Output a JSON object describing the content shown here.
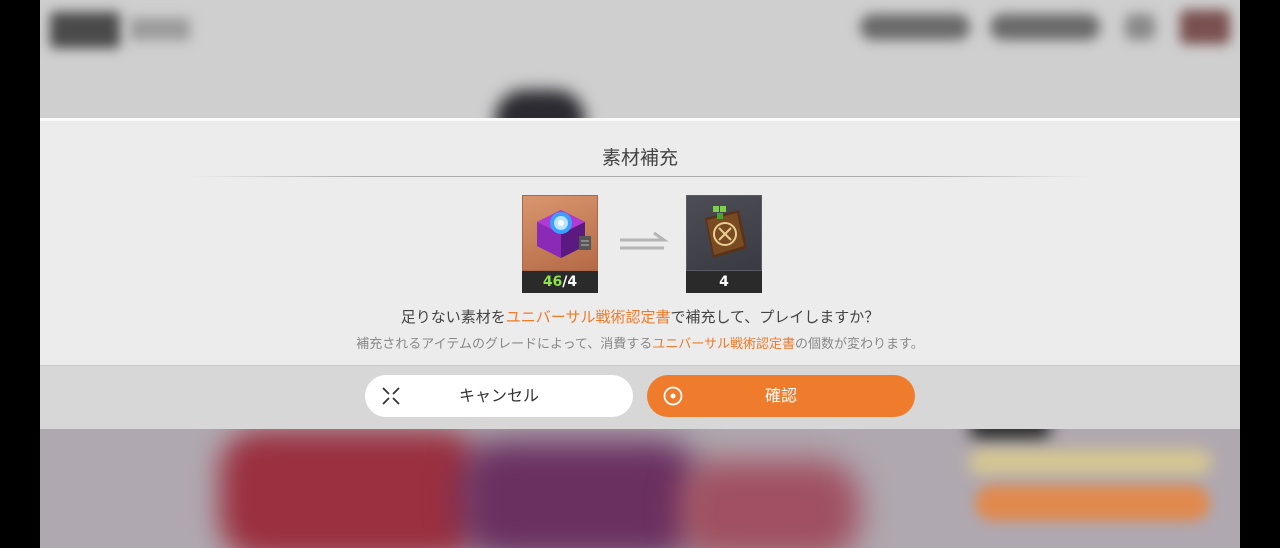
{
  "dialog": {
    "title": "素材補充",
    "source_item": {
      "have": "46",
      "sep": "/",
      "need": "4",
      "icon": "blue-core-cube-icon"
    },
    "target_item": {
      "count": "4",
      "icon": "tactics-certificate-book-icon"
    },
    "message": {
      "prefix": "足りない素材を",
      "highlight": "ユニバーサル戦術認定書",
      "suffix": "で補充して、プレイしますか？"
    },
    "note": {
      "prefix": "補充されるアイテムのグレードによって、消費する",
      "highlight": "ユニバーサル戦術認定書",
      "suffix": "の個数が変わります。"
    },
    "buttons": {
      "cancel_label": "キャンセル",
      "confirm_label": "確認"
    }
  },
  "colors": {
    "accent": "#ef7c2c",
    "highlight_text": "#ee7a2a",
    "have_count": "#8ee34a"
  }
}
